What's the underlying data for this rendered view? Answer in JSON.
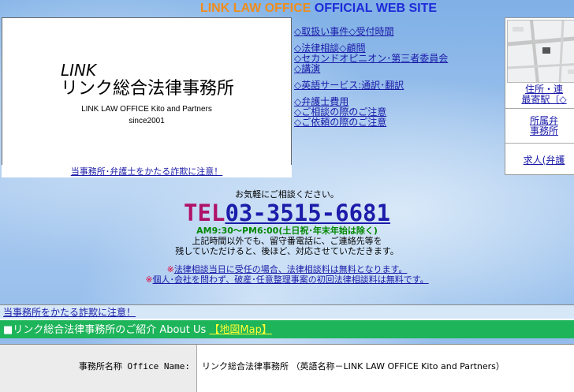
{
  "site_title": {
    "part1": "LINK LAW OFFICE",
    "part2": " OFFICIAL WEB SITE"
  },
  "logo": {
    "eng": "LINK",
    "jp": "リンク総合法律事務所",
    "sub1": "LINK LAW OFFICE  Kito and Partners",
    "sub2": "since2001"
  },
  "fraud_notice_top": "当事務所･弁護士をかたる詐欺に注意！",
  "menu": [
    [
      "◇取扱い事件",
      "◇受付時間"
    ],
    [
      "◇法律相談",
      "◇顧問",
      "◇セカンドオピニオン･第三者委員会",
      "◇講演"
    ],
    [
      "◇英語サービス:通訳･翻訳"
    ],
    [
      "◇弁護士費用",
      "◇ご相談の際のご注意",
      "◇ご依頼の際のご注意"
    ]
  ],
  "right_panel": {
    "address_link1": "住所・連",
    "address_link2": "最寄駅〔◇",
    "members1": "所属弁",
    "members2": "事務所",
    "recruit": "求人(弁護"
  },
  "contact": {
    "lead": "お気軽にご相談ください。",
    "tel_label": "TEL",
    "tel_number": "03-3515-6681",
    "hours": "AM9:30～PM6:00(土日祝･年末年始は除く)",
    "note1": "上記時間以外でも、留守番電話に、ご連絡先等を",
    "note2": "残していただけると、後ほど、対応させていただきます。",
    "notice1_mark": "※",
    "notice1": "法律相談当日に受任の場合、法律相談料は無料となります。",
    "notice2_mark": "※",
    "notice2": "個人･会社を問わず、破産･任意整理事案の初回法律相談料は無料です。"
  },
  "fraud_bar": "当事務所をかたる詐欺に注意！",
  "intro": {
    "title": "■リンク総合法律事務所のご紹介 About Us ",
    "map_link": "【地図Map】"
  },
  "table": {
    "label": "事務所名称 Office Name:",
    "value": "リンク総合法律事務所 （英語名称－LINK LAW OFFICE  Kito and Partners）"
  },
  "colors": {
    "title_orange": "#f08c1a",
    "title_blue": "#1f2bd8",
    "tel_magenta": "#b0126a",
    "tel_blue": "#1c1caa",
    "hours_green": "#008800",
    "intro_green": "#1eb45a"
  }
}
